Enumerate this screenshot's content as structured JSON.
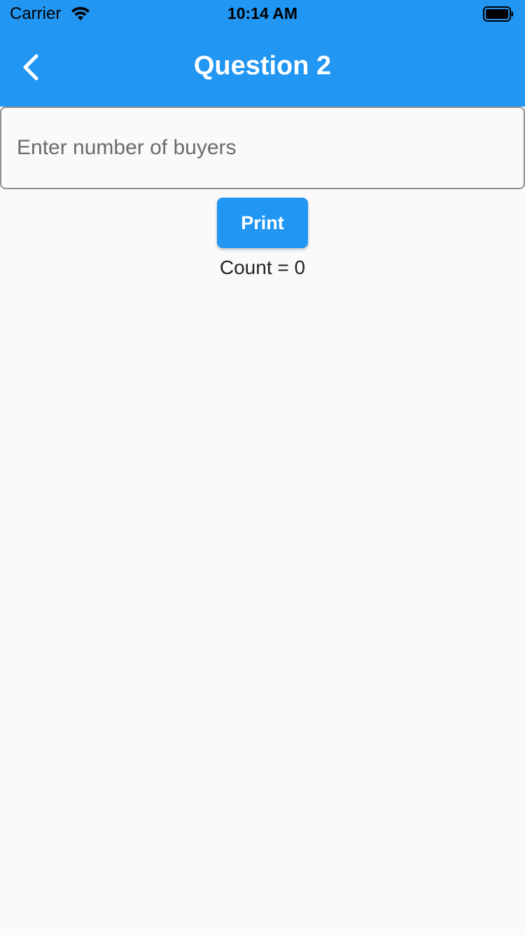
{
  "status_bar": {
    "carrier": "Carrier",
    "time": "10:14 AM",
    "icons": [
      "wifi-icon",
      "battery-icon"
    ]
  },
  "app_bar": {
    "back_icon": "chevron-left-icon",
    "title": "Question 2",
    "color": "#2196f3"
  },
  "form": {
    "buyers_input": {
      "value": "",
      "placeholder": "Enter number of buyers"
    },
    "print_button_label": "Print",
    "count_text": "Count = 0"
  }
}
